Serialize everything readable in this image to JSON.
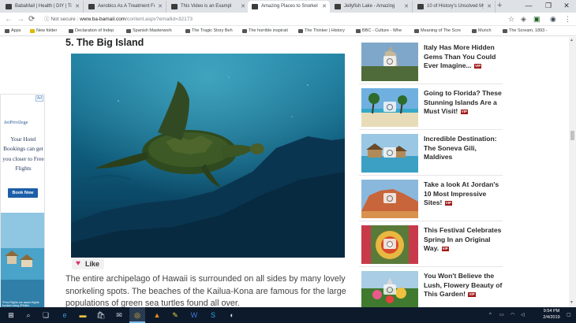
{
  "tabs": [
    {
      "title": "BabaMail | Health | DIY | Tip"
    },
    {
      "title": "Aerobics As A Treatment Fo"
    },
    {
      "title": "This Video is an Exampl"
    },
    {
      "title": "Amazing Places to Snorkel A"
    },
    {
      "title": "Jellyfish Lake - Amazing"
    },
    {
      "title": "10 of History's Unsolved My"
    }
  ],
  "address": {
    "security": "Not secure",
    "host": "www.ba-bamail.com",
    "path": "/content.aspx?emailid=32173"
  },
  "bookmarks": [
    {
      "label": "Apps"
    },
    {
      "label": "New folder"
    },
    {
      "label": "Declaration of Indep"
    },
    {
      "label": "Spanish Masterwork"
    },
    {
      "label": "The Tragic Story Beh"
    },
    {
      "label": "The horrible inspirati"
    },
    {
      "label": "The Thinker | History"
    },
    {
      "label": "BBC - Culture - Whe"
    },
    {
      "label": "Meaning of The Scre"
    },
    {
      "label": "Munch"
    },
    {
      "label": "The Scream, 1893 -"
    }
  ],
  "article": {
    "section_title": "5. The Big Island",
    "like_label": "Like",
    "body": "The entire archipelago of Hawaii is surrounded on all sides by many lovely snorkeling spots. The beaches of the Kailua-Kona are famous for the large populations of green sea turtles found all over."
  },
  "ad": {
    "badge": "Ad",
    "logo": "JetPrivilege",
    "text": "Your Hotel Bookings can get you closer to Free Flights",
    "cta": "Book Now",
    "fine_print": "*Free Flights are award flights booked using JPMiles"
  },
  "sidebar": [
    {
      "title": "Italy Has More Hidden Gems Than You Could Ever Imagine...",
      "badge": "VIP"
    },
    {
      "title": "Going to Florida? These Stunning Islands Are a Must Visit!",
      "badge": "VIP"
    },
    {
      "title": "Incredible Destination: The Soneva Gili, Maldives",
      "badge": ""
    },
    {
      "title": "Take a look At Jordan's 10 Most Impressive Sites!",
      "badge": "VIP"
    },
    {
      "title": "This Festival Celebrates Spring In an Original Way.",
      "badge": "VIP"
    },
    {
      "title": "You Won't Believe the Lush, Flowery Beauty of This Garden!",
      "badge": "VIP"
    }
  ],
  "clock": {
    "time": "9:54 PM",
    "date": "2/4/2019"
  },
  "taskbar_icons": [
    "windows-icon",
    "search-icon",
    "task-view-icon",
    "edge-icon",
    "file-explorer-icon",
    "store-icon",
    "mail-icon",
    "chrome-icon",
    "vlc-icon",
    "paint-icon",
    "word-icon",
    "skype-icon",
    "photos-icon"
  ],
  "colors": {
    "accent": "#1d5ea8",
    "vip": "#a01a1a",
    "like_heart": "#d6336c"
  }
}
